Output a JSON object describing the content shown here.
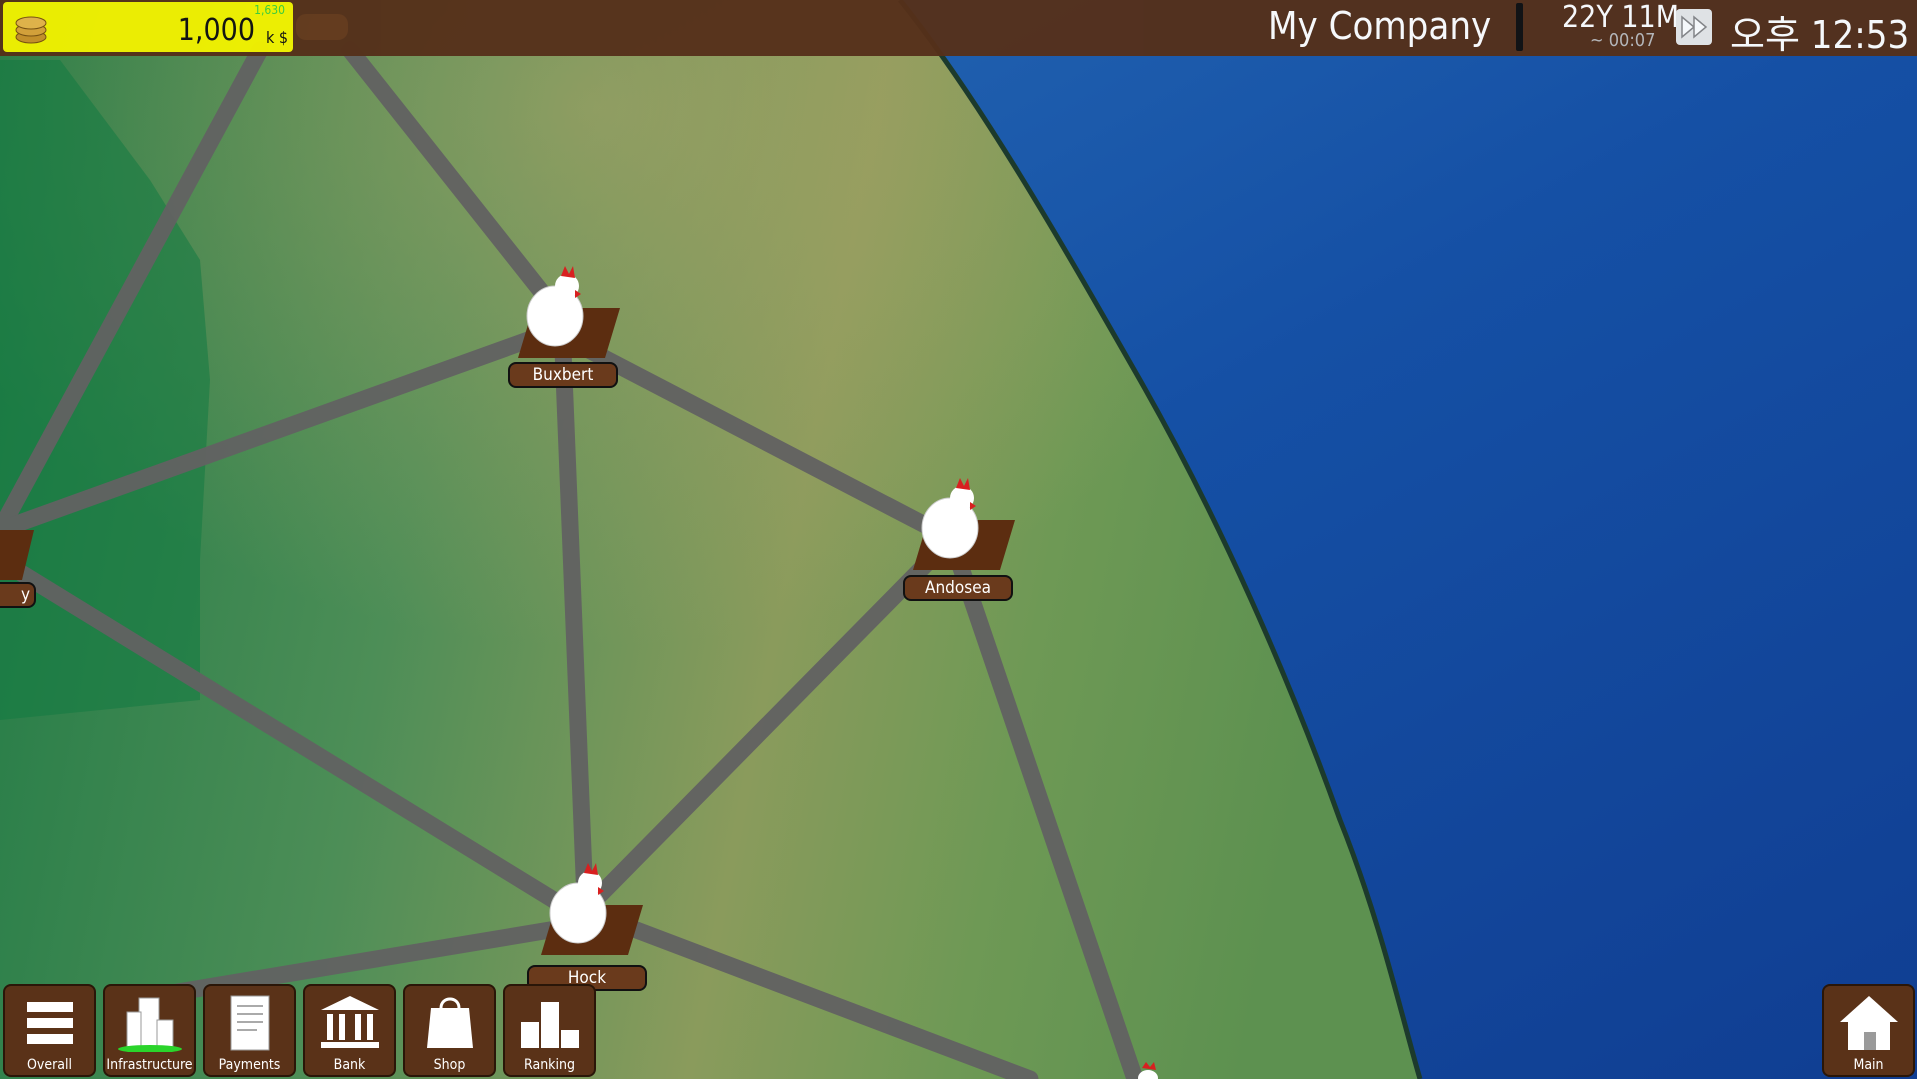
{
  "header": {
    "money": "1,000",
    "money_unit": "k $",
    "money_delta": "1,630",
    "company": "My Company",
    "date": "22Y 11M",
    "elapsed": "~ 00:07",
    "clock": "오후 12:53"
  },
  "cities": [
    {
      "name": "Buxbert"
    },
    {
      "name": "Andosea"
    },
    {
      "name": "Hock"
    },
    {
      "name": "y"
    }
  ],
  "menu": [
    {
      "label": "Overall",
      "icon": "list-icon"
    },
    {
      "label": "Infrastructure",
      "icon": "buildings-icon"
    },
    {
      "label": "Payments",
      "icon": "document-icon"
    },
    {
      "label": "Bank",
      "icon": "bank-icon"
    },
    {
      "label": "Shop",
      "icon": "bag-icon"
    },
    {
      "label": "Ranking",
      "icon": "podium-icon"
    }
  ],
  "main_button": {
    "label": "Main",
    "icon": "home-icon"
  },
  "colors": {
    "topbar": "#55301a",
    "money_bg": "#f2f200",
    "ocean": "#1a4fa0",
    "land": "#3e8a4e",
    "road": "#5f5f5f",
    "button": "#5a3218"
  }
}
